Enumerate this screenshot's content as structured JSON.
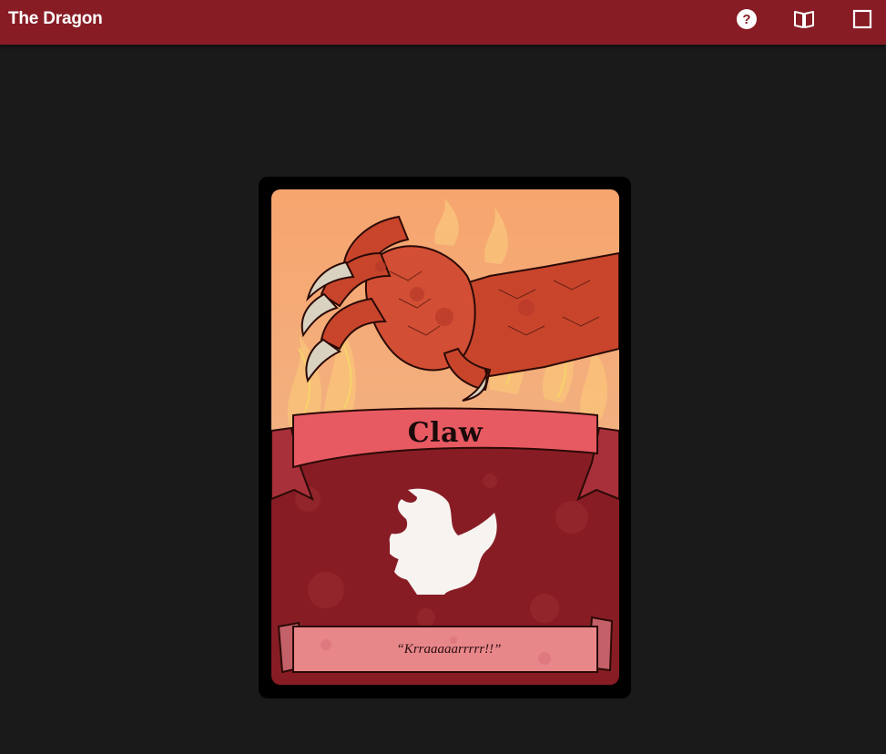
{
  "app": {
    "title": "The Dragon"
  },
  "toolbar": {
    "help_icon": "help-circle-icon",
    "rules_icon": "open-book-icon",
    "fullscreen_icon": "square-icon"
  },
  "card": {
    "name": "Claw",
    "flavor_text": "“Krraaaaarrrrr!!”",
    "symbol_icon": "claw-symbol-icon",
    "colors": {
      "frame": "#000000",
      "background_red": "#871c24",
      "banner_pink": "#e85a62",
      "scroll_pink": "#e8878a",
      "art_orange": "#f4a070"
    }
  },
  "colors": {
    "topbar": "#871c24",
    "page_background": "#1a1a1a"
  }
}
